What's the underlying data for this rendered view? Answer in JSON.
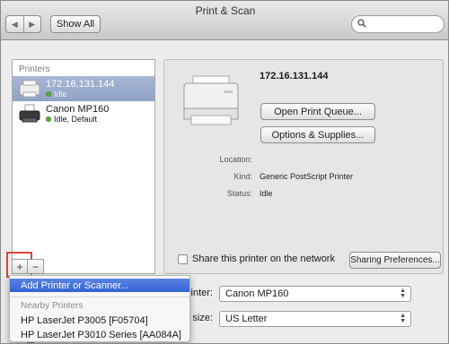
{
  "window": {
    "title": "Print & Scan"
  },
  "toolbar": {
    "back_icon": "chevron-left-icon",
    "forward_icon": "chevron-right-icon",
    "show_all_label": "Show All",
    "search_placeholder": ""
  },
  "sidebar": {
    "header": "Printers",
    "items": [
      {
        "name": "172.16.131.144",
        "status": "Idle",
        "selected": true
      },
      {
        "name": "Canon MP160",
        "status": "Idle, Default",
        "selected": false
      }
    ],
    "add_label": "+",
    "remove_label": "−"
  },
  "detail": {
    "title": "172.16.131.144",
    "open_queue_label": "Open Print Queue...",
    "options_label": "Options & Supplies...",
    "fields": [
      {
        "label": "Location:",
        "value": ""
      },
      {
        "label": "Kind:",
        "value": "Generic PostScript Printer"
      },
      {
        "label": "Status:",
        "value": "Idle"
      }
    ],
    "share_label": "Share this printer on the network",
    "sharing_prefs_label": "Sharing Preferences..."
  },
  "defaults": {
    "printer_label": "Default printer:",
    "printer_label_visible": "rinter:",
    "printer_value": "Canon MP160",
    "paper_label_visible": "size:",
    "paper_value": "US Letter"
  },
  "add_menu": {
    "add_label": "Add Printer or Scanner...",
    "nearby_header": "Nearby Printers",
    "nearby": [
      "HP LaserJet P3005 [F05704]",
      "HP LaserJet P3010 Series [AA084A]"
    ]
  },
  "colors": {
    "selection": "#8fa3c6",
    "menu_highlight": "#3262d6",
    "callout": "#d9463a",
    "status_dot": "#58b23a"
  }
}
